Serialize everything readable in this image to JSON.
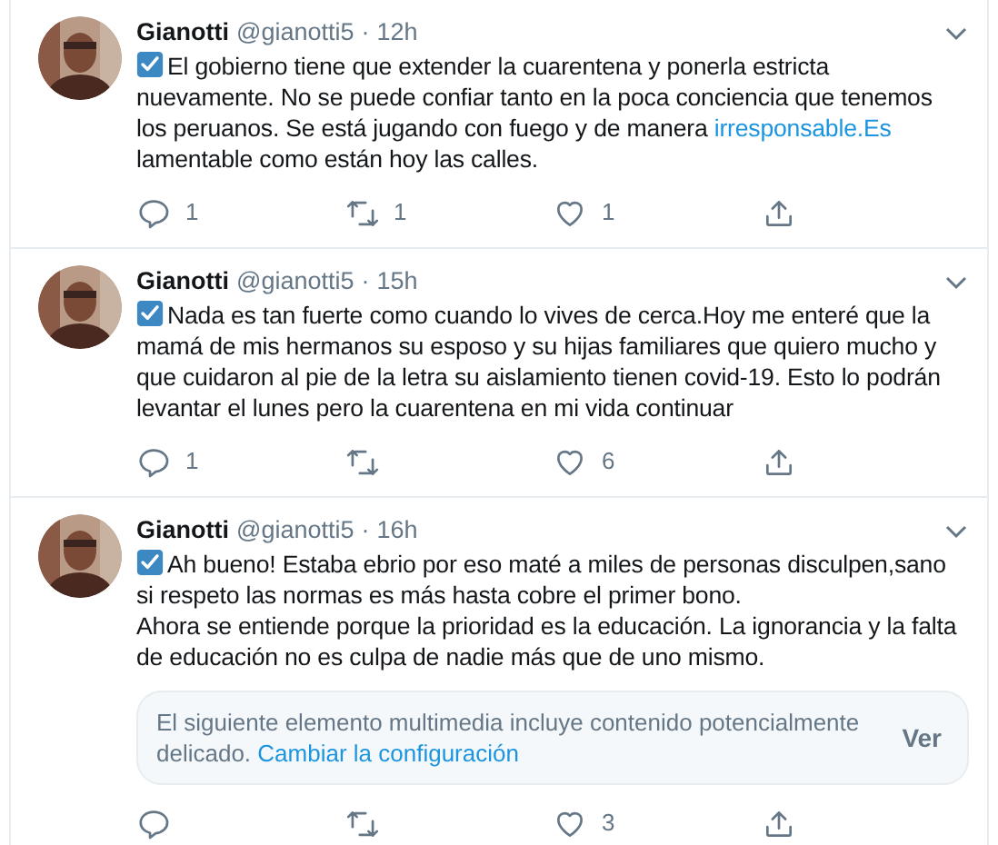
{
  "tweets": [
    {
      "name": "Gianotti",
      "handle": "@gianotti5",
      "separator": "·",
      "time": "12h",
      "avatar": {
        "kind": "picture"
      },
      "body": [
        [
          {
            "kind": "text",
            "text": "El gobierno tiene que extender la cuarentena y ponerla estricta nuevamente. No se puede confiar tanto en la poca conciencia que tenemos los peruanos. Se está jugando con fuego y de manera "
          },
          {
            "kind": "link",
            "text": "irresponsable.Es"
          },
          {
            "kind": "text",
            "text": " lamentable como están hoy las calles."
          }
        ]
      ],
      "actions": [
        {
          "kind": "reply",
          "count": "1"
        },
        {
          "kind": "retweet",
          "count": "1"
        },
        {
          "kind": "like",
          "count": "1"
        },
        {
          "kind": "share"
        }
      ]
    },
    {
      "name": "Gianotti",
      "handle": "@gianotti5",
      "separator": "·",
      "time": "15h",
      "avatar": {
        "kind": "picture"
      },
      "body": [
        [
          {
            "kind": "text",
            "text": "Nada es tan fuerte como cuando lo vives de cerca.Hoy me enteré que la mamá de mis hermanos su esposo y su hijas familiares que quiero mucho y que cuidaron al pie de la letra su aislamiento tienen covid-19. Esto lo podrán levantar el lunes pero la cuarentena en mi vida continuar"
          }
        ]
      ],
      "actions": [
        {
          "kind": "reply",
          "count": "1"
        },
        {
          "kind": "retweet"
        },
        {
          "kind": "like",
          "count": "6"
        },
        {
          "kind": "share"
        }
      ]
    },
    {
      "name": "Gianotti",
      "handle": "@gianotti5",
      "separator": "·",
      "time": "16h",
      "avatar": {
        "kind": "picture"
      },
      "body": [
        [
          {
            "kind": "text",
            "text": "Ah bueno! Estaba ebrio por eso maté a miles de personas disculpen,sano si respeto las normas es más hasta cobre el primer bono."
          }
        ],
        [
          {
            "kind": "text",
            "text": "Ahora se entiende porque la prioridad es la educación. La ignorancia y la falta de educación no es culpa de nadie más que de uno mismo."
          }
        ]
      ],
      "notice": {
        "text": "El siguiente elemento multimedia incluye contenido potencialmente delicado.",
        "link": "Cambiar la configuración",
        "button": "Ver"
      },
      "actions": [
        {
          "kind": "reply"
        },
        {
          "kind": "retweet"
        },
        {
          "kind": "like",
          "count": "3"
        },
        {
          "kind": "share"
        }
      ]
    }
  ]
}
